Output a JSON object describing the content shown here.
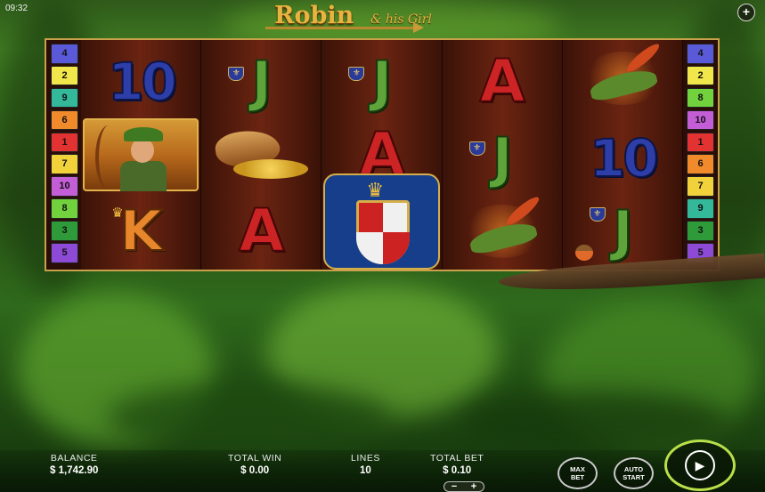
{
  "status": {
    "time": "09:32"
  },
  "header": {
    "title_main": "Robin",
    "title_sub": "& his Girl",
    "menu_icon": "plus-icon"
  },
  "reels": {
    "grid": [
      [
        "10",
        "robin",
        "K"
      ],
      [
        "J",
        "purse",
        "A"
      ],
      [
        "J",
        "A",
        "shield"
      ],
      [
        "A",
        "J",
        "hat"
      ],
      [
        "hat",
        "10",
        "J"
      ]
    ]
  },
  "paylines": {
    "left": [
      {
        "n": "4",
        "color": "#5a5ad8"
      },
      {
        "n": "2",
        "color": "#f1e64a"
      },
      {
        "n": "9",
        "color": "#34b89a"
      },
      {
        "n": "6",
        "color": "#f08a2a"
      },
      {
        "n": "1",
        "color": "#e23232"
      },
      {
        "n": "7",
        "color": "#f2d23a"
      },
      {
        "n": "10",
        "color": "#c45ed6"
      },
      {
        "n": "8",
        "color": "#72d23e"
      },
      {
        "n": "3",
        "color": "#2f9a3a"
      },
      {
        "n": "5",
        "color": "#8c4ad6"
      }
    ],
    "right": [
      {
        "n": "4",
        "color": "#5a5ad8"
      },
      {
        "n": "2",
        "color": "#f1e64a"
      },
      {
        "n": "8",
        "color": "#72d23e"
      },
      {
        "n": "10",
        "color": "#c45ed6"
      },
      {
        "n": "1",
        "color": "#e23232"
      },
      {
        "n": "6",
        "color": "#f08a2a"
      },
      {
        "n": "7",
        "color": "#f2d23a"
      },
      {
        "n": "9",
        "color": "#34b89a"
      },
      {
        "n": "3",
        "color": "#2f9a3a"
      },
      {
        "n": "5",
        "color": "#8c4ad6"
      }
    ]
  },
  "footer": {
    "balance_label": "BALANCE",
    "balance_value": "$ 1,742.90",
    "total_win_label": "TOTAL WIN",
    "total_win_value": "$ 0.00",
    "lines_label": "LINES",
    "lines_value": "10",
    "total_bet_label": "TOTAL BET",
    "total_bet_value": "$ 0.10",
    "bet_minus": "−",
    "bet_plus": "+",
    "max_bet_line1": "MAX",
    "max_bet_line2": "BET",
    "auto_start_line1": "AUTO",
    "auto_start_line2": "START",
    "spin_icon": "spin-icon"
  }
}
